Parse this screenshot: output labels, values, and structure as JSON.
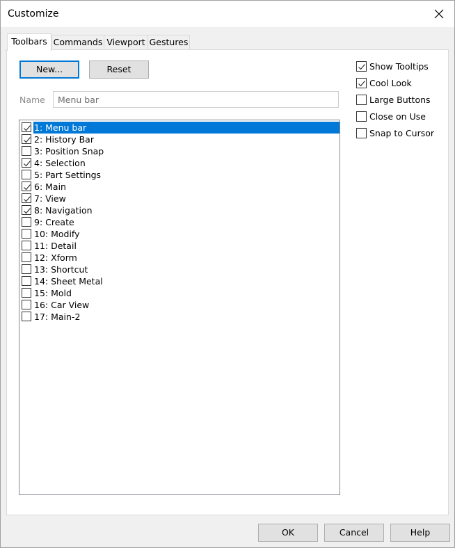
{
  "window": {
    "title": "Customize",
    "close_label": "✕"
  },
  "tabs": [
    {
      "label": "Toolbars",
      "active": true
    },
    {
      "label": "Commands",
      "active": false
    },
    {
      "label": "Viewport",
      "active": false
    },
    {
      "label": "Gestures",
      "active": false
    }
  ],
  "toolbar_panel": {
    "new_button": "New...",
    "reset_button": "Reset",
    "name_label": "Name",
    "name_value": "Menu bar"
  },
  "toolbars_list": [
    {
      "label": "1: Menu bar",
      "checked": true,
      "selected": true
    },
    {
      "label": "2: History Bar",
      "checked": true,
      "selected": false
    },
    {
      "label": "3: Position Snap",
      "checked": false,
      "selected": false
    },
    {
      "label": "4: Selection",
      "checked": true,
      "selected": false
    },
    {
      "label": "5: Part Settings",
      "checked": false,
      "selected": false
    },
    {
      "label": "6: Main",
      "checked": true,
      "selected": false
    },
    {
      "label": "7: View",
      "checked": true,
      "selected": false
    },
    {
      "label": "8: Navigation",
      "checked": true,
      "selected": false
    },
    {
      "label": "9: Create",
      "checked": false,
      "selected": false
    },
    {
      "label": "10: Modify",
      "checked": false,
      "selected": false
    },
    {
      "label": "11: Detail",
      "checked": false,
      "selected": false
    },
    {
      "label": "12: Xform",
      "checked": false,
      "selected": false
    },
    {
      "label": "13: Shortcut",
      "checked": false,
      "selected": false
    },
    {
      "label": "14: Sheet Metal",
      "checked": false,
      "selected": false
    },
    {
      "label": "15: Mold",
      "checked": false,
      "selected": false
    },
    {
      "label": "16: Car View",
      "checked": false,
      "selected": false
    },
    {
      "label": "17: Main-2",
      "checked": false,
      "selected": false
    }
  ],
  "options": [
    {
      "label": "Show Tooltips",
      "checked": true
    },
    {
      "label": "Cool Look",
      "checked": true
    },
    {
      "label": "Large Buttons",
      "checked": false
    },
    {
      "label": "Close on Use",
      "checked": false
    },
    {
      "label": "Snap to Cursor",
      "checked": false
    }
  ],
  "footer": {
    "ok": "OK",
    "cancel": "Cancel",
    "help": "Help"
  },
  "colors": {
    "selection": "#0078d7",
    "focus_border": "#0078d7"
  }
}
